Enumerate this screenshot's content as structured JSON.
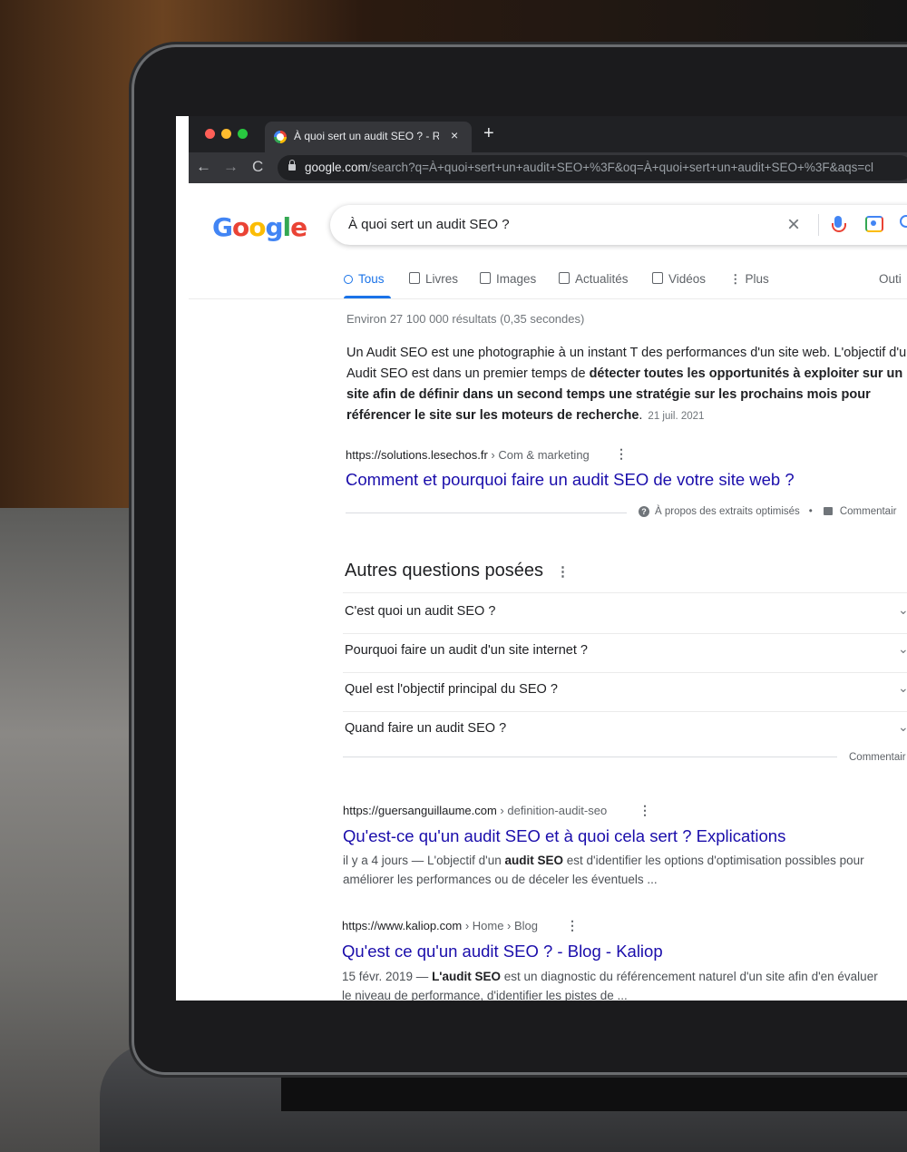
{
  "browser": {
    "tab_title": "À quoi sert un audit SEO ? - Re",
    "tab_close": "×",
    "new_tab": "+",
    "url_host": "google.com",
    "url_rest": "/search?q=À+quoi+sert+un+audit+SEO+%3F&oq=À+quoi+sert+un+audit+SEO+%3F&aqs=cl",
    "back": "←",
    "forward": "→",
    "reload": "C"
  },
  "google": {
    "logo": "Google",
    "query": "À quoi sert un audit SEO ?",
    "clear": "×",
    "tabs": [
      {
        "label": "Tous"
      },
      {
        "label": "Livres"
      },
      {
        "label": "Images"
      },
      {
        "label": "Actualités"
      },
      {
        "label": "Vidéos"
      },
      {
        "label": "Plus"
      },
      {
        "label": "Outi"
      }
    ],
    "result_stats": "Environ 27 100 000 résultats (0,35 secondes)"
  },
  "featured": {
    "text_plain": "Un Audit SEO est une photographie à un instant T des performances d'un site web. L'objectif d'un Audit SEO est dans un premier temps de ",
    "text_bold": "détecter toutes les opportunités à exploiter sur un site afin de définir dans un second temps une stratégie sur les prochains mois pour référencer le site sur les moteurs de recherche",
    "text_end": ".",
    "date": "21 juil. 2021",
    "cite_url": "https://solutions.lesechos.fr",
    "cite_crumb": " › Com & marketing",
    "title": "Comment et pourquoi faire un audit SEO de votre site web ?",
    "about": "À propos des extraits optimisés",
    "comment": "Commentair"
  },
  "paa": {
    "title": "Autres questions posées",
    "questions": [
      "C'est quoi un audit SEO ?",
      "Pourquoi faire un audit d'un site internet ?",
      "Quel est l'objectif principal du SEO ?",
      "Quand faire un audit SEO ?"
    ],
    "comment": "Commentair"
  },
  "results": [
    {
      "cite_url": "https://guersanguillaume.com",
      "cite_crumb": " › definition-audit-seo",
      "title": "Qu'est-ce qu'un audit SEO et à quoi cela sert ? Explications",
      "desc_pre": "il y a 4 jours — L'objectif d'un ",
      "desc_bold": "audit SEO",
      "desc_post": " est d'identifier les options d'optimisation possibles pour améliorer les performances ou de déceler les éventuels ..."
    },
    {
      "cite_url": "https://www.kaliop.com",
      "cite_crumb": " › Home › Blog",
      "title": "Qu'est ce qu'un audit SEO ? - Blog - Kaliop",
      "desc_pre": "15 févr. 2019 — ",
      "desc_bold": "L'audit SEO",
      "desc_post": " est un diagnostic du référencement naturel d'un site afin d'en évaluer le niveau de performance, d'identifier les pistes de ..."
    }
  ]
}
